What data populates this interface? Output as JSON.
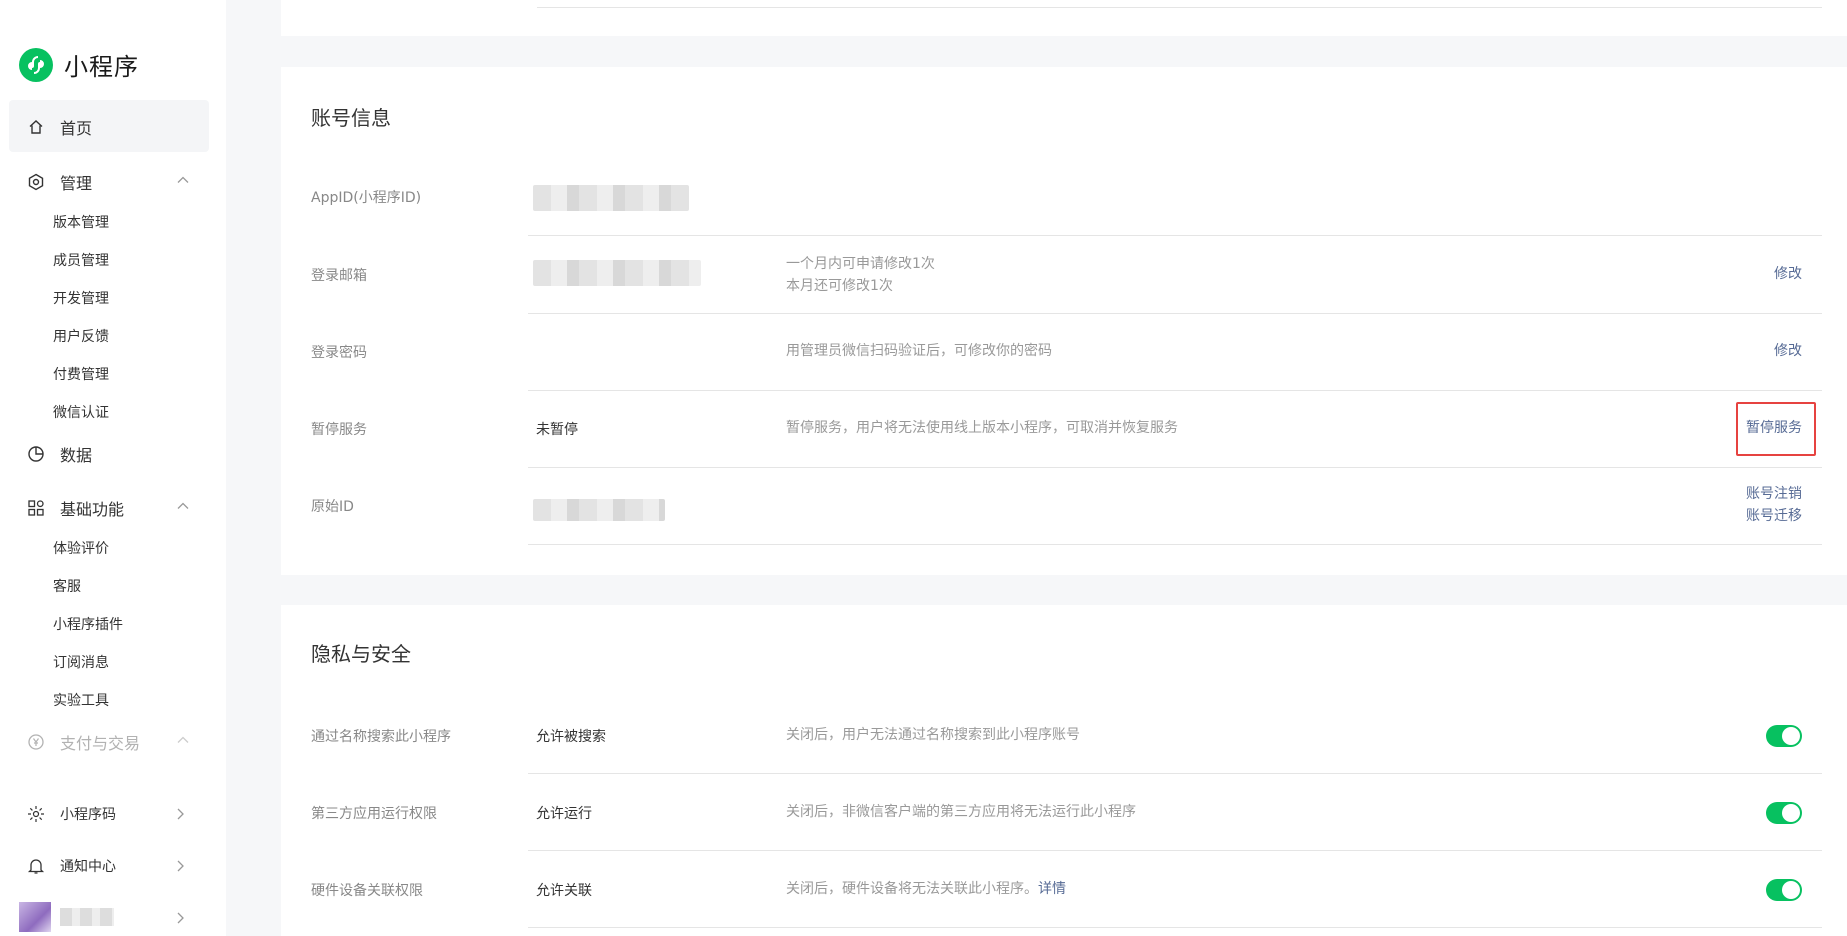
{
  "app": {
    "title": "小程序"
  },
  "nav": {
    "home": "首页",
    "manage": {
      "label": "管理",
      "items": [
        "版本管理",
        "成员管理",
        "开发管理",
        "用户反馈",
        "付费管理",
        "微信认证"
      ]
    },
    "data": "数据",
    "basic": {
      "label": "基础功能",
      "items": [
        "体验评价",
        "客服",
        "小程序插件",
        "订阅消息",
        "实验工具"
      ]
    },
    "pay": "支付与交易",
    "qrcode": "小程序码",
    "notify": "通知中心"
  },
  "account": {
    "title": "账号信息",
    "rows": [
      {
        "label": "AppID(小程序ID)"
      },
      {
        "label": "登录邮箱",
        "desc1": "一个月内可申请修改1次",
        "desc2": "本月还可修改1次",
        "action": "修改"
      },
      {
        "label": "登录密码",
        "desc": "用管理员微信扫码验证后，可修改你的密码",
        "action": "修改"
      },
      {
        "label": "暂停服务",
        "value": "未暂停",
        "desc": "暂停服务，用户将无法使用线上版本小程序，可取消并恢复服务",
        "action": "暂停服务"
      },
      {
        "label": "原始ID",
        "action1": "账号注销",
        "action2": "账号迁移"
      }
    ]
  },
  "privacy": {
    "title": "隐私与安全",
    "rows": [
      {
        "label": "通过名称搜索此小程序",
        "value": "允许被搜索",
        "desc": "关闭后，用户无法通过名称搜索到此小程序账号",
        "enabled": true
      },
      {
        "label": "第三方应用运行权限",
        "value": "允许运行",
        "desc": "关闭后，非微信客户端的第三方应用将无法运行此小程序",
        "enabled": true
      },
      {
        "label": "硬件设备关联权限",
        "value": "允许关联",
        "desc": "关闭后，硬件设备将无法关联此小程序。",
        "desc_link": "详情",
        "enabled": true
      }
    ]
  },
  "colors": {
    "brand": "#07c160",
    "link": "#576b95",
    "highlight": "#e64340"
  }
}
